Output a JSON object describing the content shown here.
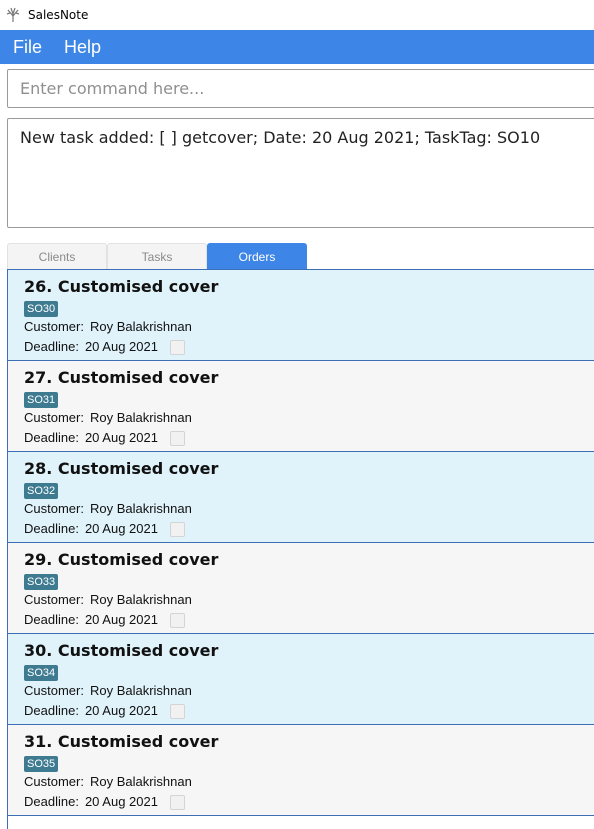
{
  "window": {
    "title": "SalesNote"
  },
  "menu": [
    {
      "label": "File"
    },
    {
      "label": "Help"
    }
  ],
  "command": {
    "placeholder": "Enter command here...",
    "value": ""
  },
  "result": {
    "message": "New task added: [ ] getcover; Date: 20 Aug 2021; TaskTag: SO10"
  },
  "tabs": [
    {
      "label": "Clients",
      "active": false
    },
    {
      "label": "Tasks",
      "active": false
    },
    {
      "label": "Orders",
      "active": true
    }
  ],
  "orders": [
    {
      "title": "26. Customised cover",
      "tag": "SO30",
      "customer_label": "Customer:",
      "customer": "Roy Balakrishnan",
      "deadline_label": "Deadline:",
      "deadline": "20 Aug 2021"
    },
    {
      "title": "27. Customised cover",
      "tag": "SO31",
      "customer_label": "Customer:",
      "customer": "Roy Balakrishnan",
      "deadline_label": "Deadline:",
      "deadline": "20 Aug 2021"
    },
    {
      "title": "28. Customised cover",
      "tag": "SO32",
      "customer_label": "Customer:",
      "customer": "Roy Balakrishnan",
      "deadline_label": "Deadline:",
      "deadline": "20 Aug 2021"
    },
    {
      "title": "29. Customised cover",
      "tag": "SO33",
      "customer_label": "Customer:",
      "customer": "Roy Balakrishnan",
      "deadline_label": "Deadline:",
      "deadline": "20 Aug 2021"
    },
    {
      "title": "30. Customised cover",
      "tag": "SO34",
      "customer_label": "Customer:",
      "customer": "Roy Balakrishnan",
      "deadline_label": "Deadline:",
      "deadline": "20 Aug 2021"
    },
    {
      "title": "31. Customised cover",
      "tag": "SO35",
      "customer_label": "Customer:",
      "customer": "Roy Balakrishnan",
      "deadline_label": "Deadline:",
      "deadline": "20 Aug 2021"
    }
  ]
}
